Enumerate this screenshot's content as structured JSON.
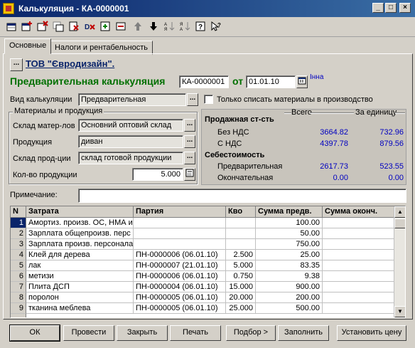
{
  "window": {
    "title": "Калькуляция - КА-0000001",
    "controls": [
      "_",
      "□",
      "×"
    ]
  },
  "toolbar": {
    "icons": [
      "new-row-icon",
      "add-row-icon",
      "delete-row-icon",
      "copy-row-icon",
      "delete-doc-icon",
      "refresh-icon",
      "move-up-icon",
      "move-down-icon",
      "sort-asc-icon",
      "sort-desc-icon",
      "help-icon",
      "whatsthis-icon"
    ]
  },
  "tabs": [
    {
      "label": "Основные"
    },
    {
      "label": "Налоги и рентабельность"
    }
  ],
  "header": {
    "ellipsis": "...",
    "org": "ТОВ \"Євродизайн\".",
    "doc_title": "Предварительная калькуляция",
    "number": "КА-0000001",
    "from_label": "от",
    "date": "01.01.10",
    "user": "Інна"
  },
  "form": {
    "calc_type_label": "Вид калькуляции",
    "calc_type_value": "Предварительная",
    "only_write_off_label": "Только списать материалы в производство",
    "group_title": "Материалы и продукция",
    "mat_warehouse_label": "Склад матер-лов",
    "mat_warehouse_value": "Основний оптовий склад",
    "product_label": "Продукция",
    "product_value": "диван",
    "prod_warehouse_label": "Склад прод-ции",
    "prod_warehouse_value": "склад готовой продукции",
    "qty_label": "Кол-во продукции",
    "qty_value": "5.000"
  },
  "summary": {
    "col_total": "Всего",
    "col_unit": "За единицу",
    "sale_cost_label": "Продажная ст-сть",
    "no_vat_label": "Без НДС",
    "no_vat_total": "3664.82",
    "no_vat_unit": "732.96",
    "with_vat_label": "С НДС",
    "with_vat_total": "4397.78",
    "with_vat_unit": "879.56",
    "cost_label": "Себестоимость",
    "prelim_label": "Предварительная",
    "prelim_total": "2617.73",
    "prelim_unit": "523.55",
    "final_label": "Окончательная",
    "final_total": "0.00",
    "final_unit": "0.00"
  },
  "note": {
    "label": "Примечание:",
    "value": ""
  },
  "table": {
    "columns": [
      "N",
      "Затрата",
      "Партия",
      "Кво",
      "Сумма предв.",
      "Сумма оконч."
    ],
    "rows": [
      [
        "1",
        "Амортиз. произв. ОС, НМА и",
        "",
        "",
        "100.00",
        ""
      ],
      [
        "2",
        "Зарплата общепроизв. перс",
        "",
        "",
        "50.00",
        ""
      ],
      [
        "3",
        "Зарплата произв. персонала",
        "",
        "",
        "750.00",
        ""
      ],
      [
        "4",
        "Клей для дерева",
        "ПН-0000006 (06.01.10)",
        "2.500",
        "25.00",
        ""
      ],
      [
        "5",
        "лак",
        "ПН-0000007 (21.01.10)",
        "5.000",
        "83.35",
        ""
      ],
      [
        "6",
        "метизи",
        "ПН-0000006 (06.01.10)",
        "0.750",
        "9.38",
        ""
      ],
      [
        "7",
        "Плита ДСП",
        "ПН-0000004 (06.01.10)",
        "15.000",
        "900.00",
        ""
      ],
      [
        "8",
        "поролон",
        "ПН-0000005 (06.01.10)",
        "20.000",
        "200.00",
        ""
      ],
      [
        "9",
        "тканина меблева",
        "ПН-0000005 (06.01.10)",
        "25.000",
        "500.00",
        ""
      ]
    ]
  },
  "buttons": {
    "ok": "ОК",
    "post": "Провести",
    "close": "Закрыть",
    "print": "Печать",
    "select": "Подбор >",
    "fill": "Заполнить",
    "set_price": "Установить цену"
  }
}
